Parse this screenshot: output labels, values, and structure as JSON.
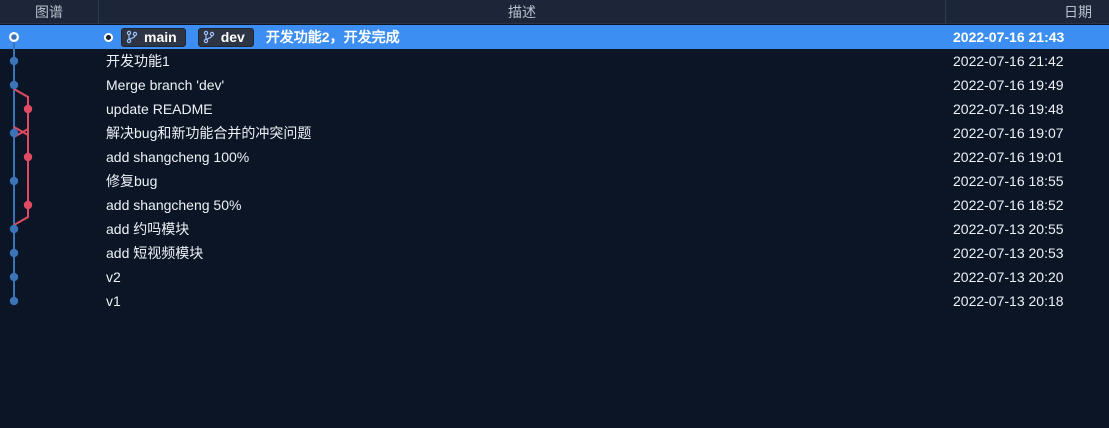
{
  "header": {
    "graph_label": "图谱",
    "desc_label": "描述",
    "date_label": "日期"
  },
  "colors": {
    "main_lane": "#3a73b8",
    "dev_lane": "#e04a62",
    "selection": "#3d8ef2"
  },
  "commits": [
    {
      "message": "开发功能2，开发完成",
      "date": "2022-07-16 21:43",
      "lane": "main",
      "selected": true,
      "refs": [
        {
          "name": "main",
          "icon": "branch-icon"
        },
        {
          "name": "dev",
          "icon": "branch-icon"
        }
      ]
    },
    {
      "message": "开发功能1",
      "date": "2022-07-16 21:42",
      "lane": "main"
    },
    {
      "message": "Merge branch 'dev'",
      "date": "2022-07-16 19:49",
      "lane": "main"
    },
    {
      "message": "update README",
      "date": "2022-07-16 19:48",
      "lane": "dev"
    },
    {
      "message": "解决bug和新功能合并的冲突问题",
      "date": "2022-07-16 19:07",
      "lane": "main"
    },
    {
      "message": "add shangcheng 100%",
      "date": "2022-07-16 19:01",
      "lane": "dev"
    },
    {
      "message": "修复bug",
      "date": "2022-07-16 18:55",
      "lane": "main"
    },
    {
      "message": "add shangcheng 50%",
      "date": "2022-07-16 18:52",
      "lane": "dev"
    },
    {
      "message": "add 约吗模块",
      "date": "2022-07-13 20:55",
      "lane": "main"
    },
    {
      "message": "add 短视频模块",
      "date": "2022-07-13 20:53",
      "lane": "main"
    },
    {
      "message": "v2",
      "date": "2022-07-13 20:20",
      "lane": "main"
    },
    {
      "message": "v1",
      "date": "2022-07-13 20:18",
      "lane": "main"
    }
  ]
}
